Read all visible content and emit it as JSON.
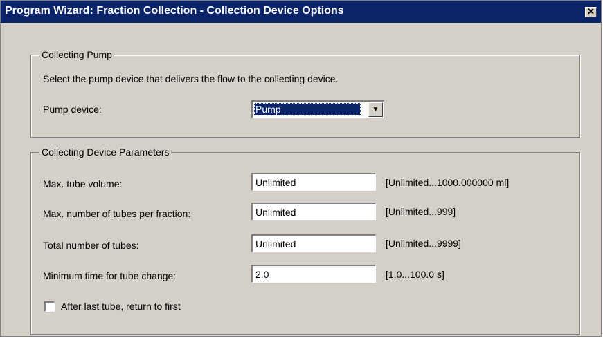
{
  "window": {
    "title": "Program Wizard: Fraction Collection - Collection Device Options",
    "close_glyph": "✕"
  },
  "collecting_pump": {
    "legend": "Collecting Pump",
    "instruction": "Select the pump device that delivers the flow to the collecting device.",
    "pump_label": "Pump device:",
    "pump_value": "Pump",
    "dropdown_glyph": "▼"
  },
  "collecting_device": {
    "legend": "Collecting Device Parameters",
    "rows": [
      {
        "label": "Max. tube  volume:",
        "value": "Unlimited",
        "range": "[Unlimited...1000.000000 ml]"
      },
      {
        "label": "Max. number of tubes per fraction:",
        "value": "Unlimited",
        "range": "[Unlimited...999]"
      },
      {
        "label": "Total number of tubes:",
        "value": "Unlimited",
        "range": "[Unlimited...9999]"
      },
      {
        "label": "Minimum time for tube change:",
        "value": "2.0",
        "range": "[1.0...100.0 s]"
      }
    ],
    "checkbox_label": "After last tube, return to first",
    "checkbox_checked": false
  }
}
